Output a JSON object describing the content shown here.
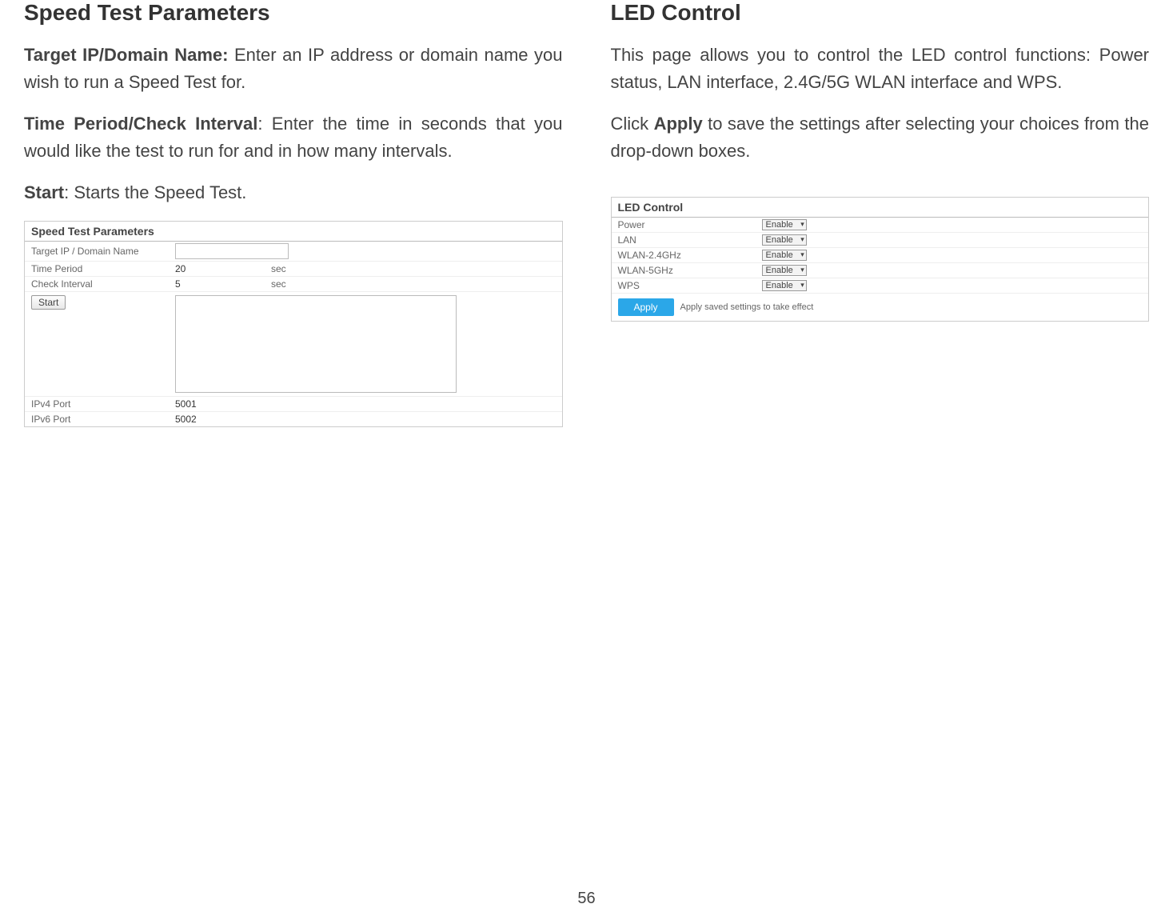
{
  "page_number": "56",
  "left": {
    "heading": "Speed Test Parameters",
    "para1_bold": "Target IP/Domain Name:",
    "para1_rest": " Enter an IP address or domain name you wish to run a Speed Test for.",
    "para2_bold": "Time Period/Check Interval",
    "para2_rest": ": Enter the time in seconds that you would like the test to run for and in how many intervals.",
    "para3_bold": "Start",
    "para3_rest": ": Starts the Speed Test.",
    "ss": {
      "title": "Speed Test Parameters",
      "rows": {
        "target_label": "Target IP / Domain Name",
        "time_label": "Time Period",
        "time_value": "20",
        "time_unit": "sec",
        "check_label": "Check Interval",
        "check_value": "5",
        "check_unit": "sec",
        "start_btn": "Start",
        "ipv4_label": "IPv4 Port",
        "ipv4_value": "5001",
        "ipv6_label": "IPv6 Port",
        "ipv6_value": "5002"
      }
    }
  },
  "right": {
    "heading": "LED Control",
    "para1": "This page allows you to control the LED control functions: Power status, LAN interface, 2.4G/5G WLAN interface and WPS.",
    "para2_pre": "Click ",
    "para2_bold": "Apply",
    "para2_post": " to save the settings after selecting your choices from the drop-down boxes.",
    "ss": {
      "title": "LED Control",
      "rows": [
        {
          "label": "Power",
          "value": "Enable"
        },
        {
          "label": "LAN",
          "value": "Enable"
        },
        {
          "label": "WLAN-2.4GHz",
          "value": "Enable"
        },
        {
          "label": "WLAN-5GHz",
          "value": "Enable"
        },
        {
          "label": "WPS",
          "value": "Enable"
        }
      ],
      "apply_btn": "Apply",
      "apply_note": "Apply saved settings to take effect"
    }
  }
}
